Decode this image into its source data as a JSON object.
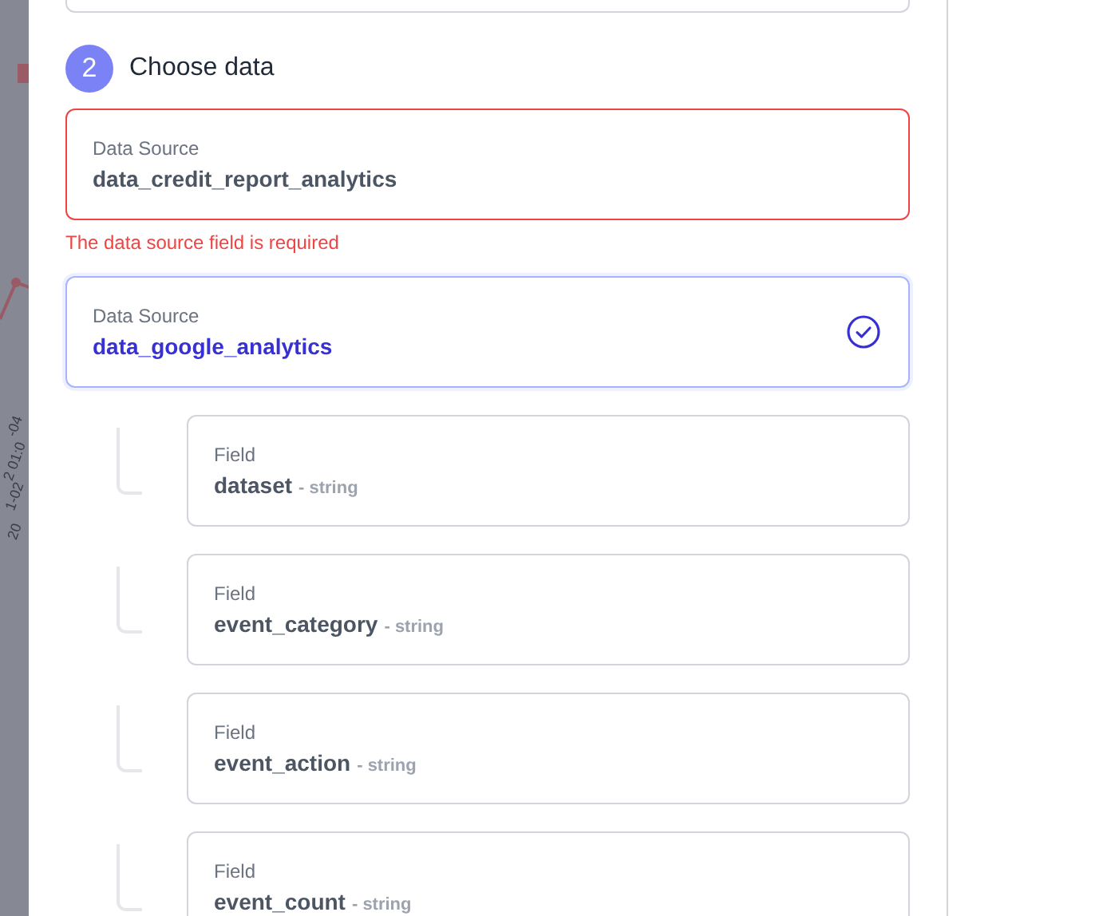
{
  "backdrop": {
    "axis_labels": [
      "-04",
      "2 01:0",
      "1-02",
      "20"
    ]
  },
  "step": {
    "number": "2",
    "title": "Choose data"
  },
  "data_sources": [
    {
      "label": "Data Source",
      "value": "data_credit_report_analytics",
      "invalid": true,
      "selected": false,
      "error": "The data source field is required"
    },
    {
      "label": "Data Source",
      "value": "data_google_analytics",
      "invalid": false,
      "selected": true
    }
  ],
  "fields": [
    {
      "label": "Field",
      "name": "dataset",
      "type": "- string"
    },
    {
      "label": "Field",
      "name": "event_category",
      "type": "- string"
    },
    {
      "label": "Field",
      "name": "event_action",
      "type": "- string"
    },
    {
      "label": "Field",
      "name": "event_count",
      "type": "- string"
    }
  ]
}
